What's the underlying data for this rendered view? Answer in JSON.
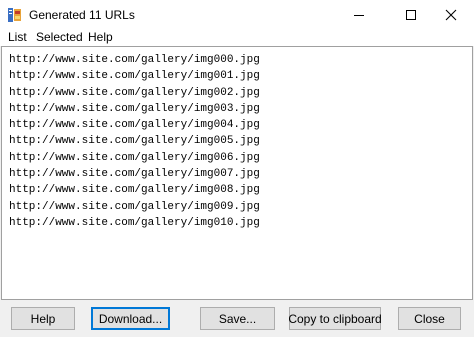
{
  "window": {
    "title": "Generated 11 URLs",
    "icon": "app-icon"
  },
  "menu": {
    "list": "List",
    "selected": "Selected",
    "help": "Help"
  },
  "urls": [
    "http://www.site.com/gallery/img000.jpg",
    "http://www.site.com/gallery/img001.jpg",
    "http://www.site.com/gallery/img002.jpg",
    "http://www.site.com/gallery/img003.jpg",
    "http://www.site.com/gallery/img004.jpg",
    "http://www.site.com/gallery/img005.jpg",
    "http://www.site.com/gallery/img006.jpg",
    "http://www.site.com/gallery/img007.jpg",
    "http://www.site.com/gallery/img008.jpg",
    "http://www.site.com/gallery/img009.jpg",
    "http://www.site.com/gallery/img010.jpg"
  ],
  "buttons": {
    "help": "Help",
    "download": "Download...",
    "save": "Save...",
    "copy": "Copy to clipboard",
    "close": "Close"
  }
}
